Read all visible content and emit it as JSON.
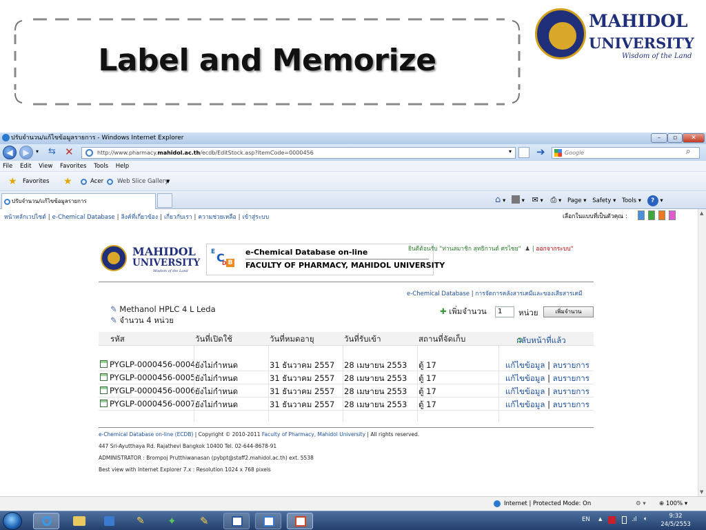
{
  "slide": {
    "title": "Label and Memorize",
    "logo": {
      "name_line1": "MAHIDOL",
      "name_line2": "UNIVERSITY",
      "tagline": "Wisdom of the Land"
    }
  },
  "window": {
    "title": "ปรับจำนวน/แก้ไขข้อมูลรายการ - Windows Internet Explorer",
    "address_prefix": "http://www.pharmacy.",
    "address_bold": "mahidol.ac.th",
    "address_suffix": "/ecdb/EditStock.asp?ItemCode=0000456",
    "search_placeholder": "Google",
    "menu": [
      "File",
      "Edit",
      "View",
      "Favorites",
      "Tools",
      "Help"
    ],
    "favorites": {
      "label": "Favorites",
      "item1": "Acer",
      "item2": "Web Slice Gallery"
    },
    "tab_title": "ปรับจำนวน/แก้ไขข้อมูลรายการ",
    "commands": {
      "page": "Page",
      "safety": "Safety",
      "tools": "Tools"
    },
    "status": {
      "zone": "Internet | Protected Mode: On",
      "zoom": "100%"
    }
  },
  "site": {
    "nav": [
      "หน้าหลักเวปไซต์",
      "e-Chemical Database",
      "ลิงค์ที่เกี่ยวข้อง",
      "เกี่ยวกับเรา",
      "ความช่วยเหลือ",
      "เข้าสู่ระบบ"
    ],
    "theme_label": "เลือกในแบบที่เป็นตัวคุณ :",
    "theme_colors": [
      "#4a90d9",
      "#3aa83a",
      "#f07a20",
      "#e05ad0"
    ],
    "logo": {
      "name_line1": "MAHIDOL",
      "name_line2": "UNIVERSITY",
      "tagline": "Wisdom of the Land"
    },
    "ecdb": {
      "line1": "e-Chemical Database on-line",
      "line2": "FACULTY OF PHARMACY, MAHIDOL UNIVERSITY"
    },
    "welcome": {
      "greeting": "ยินดีต้อนรับ \"ท่านสมาชิก สุทธิกานต์ ศรไชย\"",
      "logout": "ออกจากระบบ\""
    },
    "breadcrumb": {
      "link1": "e-Chemical Database",
      "link2": "การจัดการคลังสารเคมีและของเสียสารเคมี"
    },
    "item": {
      "name": "Methanol HPLC 4 L Leda",
      "quantity": "จำนวน 4 หน่วย"
    },
    "add": {
      "label": "เพิ่มจำนวน",
      "value": "1",
      "unit": "หน่วย",
      "button": "เพิ่มจำนวน"
    },
    "table": {
      "headers": [
        "รหัส",
        "วันที่เปิดใช้",
        "วันที่หมดอายุ",
        "วันที่รับเข้า",
        "สถานที่จัดเก็บ"
      ],
      "back_link": "กลับหน้าที่แล้ว",
      "rows": [
        {
          "code": "PYGLP-0000456-0004",
          "opened": "ยังไม่กำหนด",
          "expiry": "31 ธันวาคม 2557",
          "received": "28 เมษายน 2553",
          "location": "ตู้ 17",
          "edit": "แก้ไขข้อมูล",
          "delete": "ลบรายการ"
        },
        {
          "code": "PYGLP-0000456-0005",
          "opened": "ยังไม่กำหนด",
          "expiry": "31 ธันวาคม 2557",
          "received": "28 เมษายน 2553",
          "location": "ตู้ 17",
          "edit": "แก้ไขข้อมูล",
          "delete": "ลบรายการ"
        },
        {
          "code": "PYGLP-0000456-0006",
          "opened": "ยังไม่กำหนด",
          "expiry": "31 ธันวาคม 2557",
          "received": "28 เมษายน 2553",
          "location": "ตู้ 17",
          "edit": "แก้ไขข้อมูล",
          "delete": "ลบรายการ"
        },
        {
          "code": "PYGLP-0000456-0007",
          "opened": "ยังไม่กำหนด",
          "expiry": "31 ธันวาคม 2557",
          "received": "28 เมษายน 2553",
          "location": "ตู้ 17",
          "edit": "แก้ไขข้อมูล",
          "delete": "ลบรายการ"
        }
      ]
    },
    "footer": {
      "line1_link1": "e-Chemical Database on-line (ECDB)",
      "line1_text": " | Copyright © 2010-2011 ",
      "line1_link2": "Faculty of Pharmacy, Mahidol University",
      "line1_end": " | All rights reserved.",
      "line2": "447 Sri-Ayutthaya Rd. Rajathevi Bangkok 10400 Tel. 02-644-8678-91",
      "line3": "ADMINISTRATOR : Brompoj Prutthiwanasan (pybpt@staff2.mahidol.ac.th) ext. 5538",
      "line4": "Best view with Internet Explorer 7.x : Resolution 1024 x 768 pixels"
    }
  },
  "taskbar": {
    "lang": "EN",
    "time": "9:32",
    "date": "24/5/2553"
  }
}
